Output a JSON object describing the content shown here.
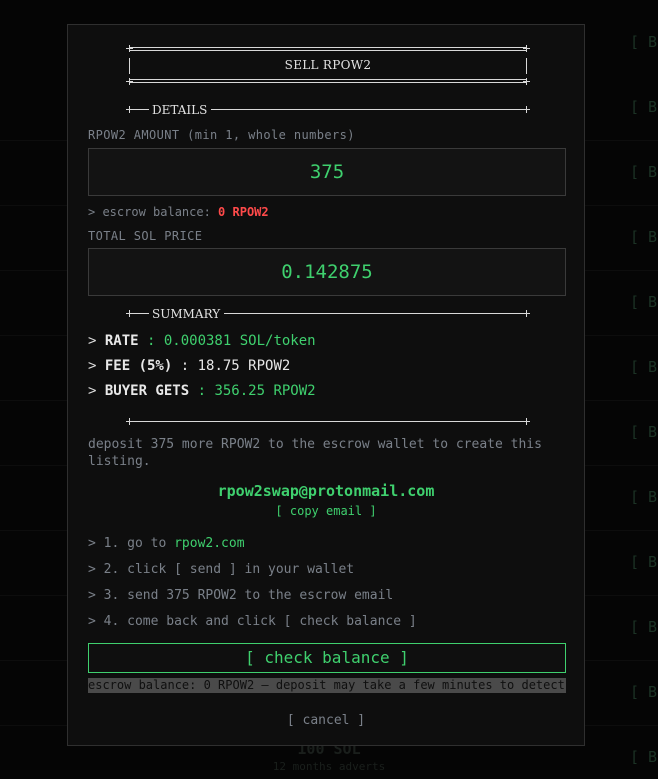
{
  "background": {
    "list_glyph": "[ B",
    "bottom_amount": "100 SOL",
    "bottom_sub": "12 months adverts"
  },
  "modal": {
    "title": "SELL RPOW2",
    "details_heading": "DETAILS",
    "amount_label": "RPOW2 AMOUNT (min 1, whole numbers)",
    "amount_value": "375",
    "escrow_prefix": "> escrow balance: ",
    "escrow_value": "0 RPOW2",
    "price_label": "TOTAL SOL PRICE",
    "price_value": "0.142875",
    "summary_heading": "SUMMARY",
    "summary": {
      "rate_prefix": "> ",
      "rate_key": "RATE",
      "rate_value": " : 0.000381 SOL/token",
      "fee_prefix": "> ",
      "fee_key": "FEE (5%)",
      "fee_value": " : 18.75 RPOW2",
      "buyer_prefix": "> ",
      "buyer_key": "BUYER GETS",
      "buyer_value": " : 356.25 RPOW2"
    },
    "deposit_text": "deposit 375 more RPOW2 to the escrow wallet to create this listing.",
    "email": "rpow2swap@protonmail.com",
    "copy_email_label": "[ copy email ]",
    "steps": {
      "s1_prefix": "> 1. go to ",
      "s1_link": "rpow2.com",
      "s2": "> 2. click [ send ] in your wallet",
      "s3": "> 3. send 375 RPOW2 to the escrow email",
      "s4": "> 4. come back and click [ check balance ]"
    },
    "check_balance_label": "[ check balance ]",
    "status_text": "escrow balance: 0 RPOW2 — deposit may take a few minutes to detect",
    "cancel_label": "[ cancel ]"
  },
  "colors": {
    "accent": "#3fd06e",
    "danger": "#ff4a4a",
    "modal_bg": "#0e0e0e",
    "page_bg": "#050505"
  }
}
